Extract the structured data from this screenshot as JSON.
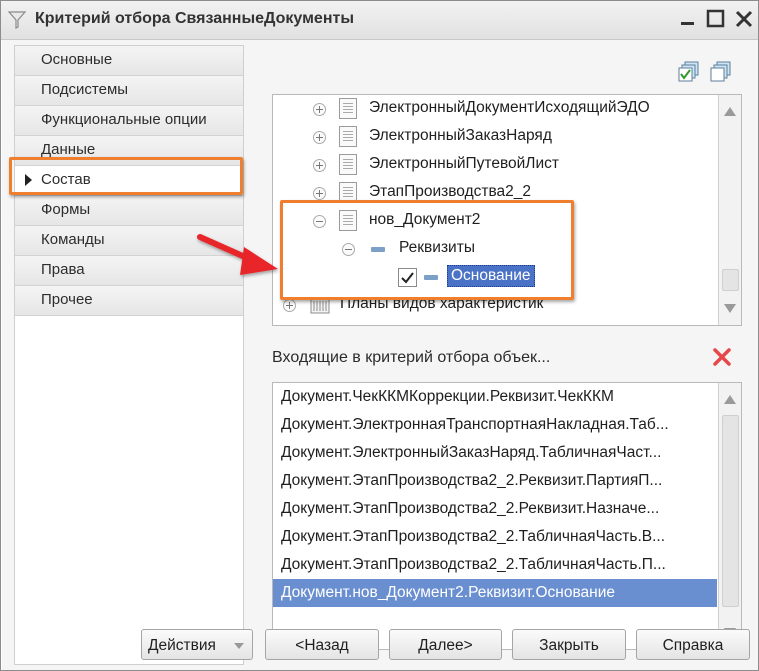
{
  "window": {
    "title": "Критерий отбора СвязанныеДокументы"
  },
  "sidebar": {
    "items": [
      {
        "label": "Основные"
      },
      {
        "label": "Подсистемы"
      },
      {
        "label": "Функциональные опции"
      },
      {
        "label": "Данные"
      },
      {
        "label": "Состав",
        "active": true
      },
      {
        "label": "Формы"
      },
      {
        "label": "Команды"
      },
      {
        "label": "Права"
      },
      {
        "label": "Прочее"
      }
    ]
  },
  "tree": {
    "rows": [
      {
        "label": "ЭлектронныйДокументИсходящийЭДО",
        "expander": "plus",
        "icon": "document-icon"
      },
      {
        "label": "ЭлектронныйЗаказНаряд",
        "expander": "plus",
        "icon": "document-icon"
      },
      {
        "label": "ЭлектронныйПутевойЛист",
        "expander": "plus",
        "icon": "document-icon"
      },
      {
        "label": "ЭтапПроизводства2_2",
        "expander": "plus",
        "icon": "document-icon"
      },
      {
        "label": "нов_Документ2",
        "expander": "minus",
        "icon": "document-icon"
      },
      {
        "label": "Реквизиты",
        "expander": "minus",
        "icon": "attributes-icon"
      },
      {
        "label": "Основание",
        "checked": true,
        "icon": "attribute-icon",
        "selected": true
      },
      {
        "label": "Планы видов характеристик",
        "expander": "plus",
        "icon": "chart-of-characteristic-types-icon"
      }
    ]
  },
  "included": {
    "label": "Входящие в критерий отбора объек...",
    "items": [
      "Документ.ЧекККМКоррекции.Реквизит.ЧекККМ",
      "Документ.ЭлектроннаяТранспортнаяНакладная.Таб...",
      "Документ.ЭлектронныйЗаказНаряд.ТабличнаяЧаст...",
      "Документ.ЭтапПроизводства2_2.Реквизит.ПартияП...",
      "Документ.ЭтапПроизводства2_2.Реквизит.Назначе...",
      "Документ.ЭтапПроизводства2_2.ТабличнаяЧасть.В...",
      "Документ.ЭтапПроизводства2_2.ТабличнаяЧасть.П...",
      "Документ.нов_Документ2.Реквизит.Основание"
    ],
    "selected_index": 7
  },
  "buttons": {
    "actions": "Действия",
    "back": "<Назад",
    "next": "Далее>",
    "close": "Закрыть",
    "help": "Справка"
  },
  "colors": {
    "highlight": "#ef7f2f",
    "selection": "#6a8fd0",
    "arrow": "#e8262a"
  }
}
